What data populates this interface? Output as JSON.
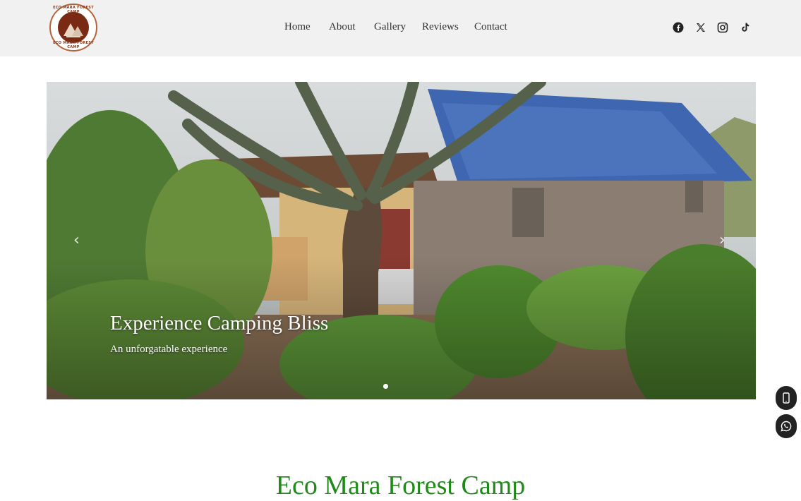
{
  "header": {
    "logo_text_top": "ECO MARA FOREST CAMP",
    "logo_text_bottom": "ECO MARA FOREST CAMP",
    "nav": [
      {
        "label": "Home"
      },
      {
        "label": "About"
      },
      {
        "label": "Gallery"
      },
      {
        "label": "Reviews"
      },
      {
        "label": "Contact"
      }
    ],
    "social_icons": [
      "facebook-icon",
      "x-icon",
      "instagram-icon",
      "tiktok-icon"
    ]
  },
  "hero": {
    "title": "Experience Camping Bliss",
    "subtitle": "An unforgatable experience",
    "prev_arrow": "‹",
    "next_arrow": "›",
    "slides_count": 3,
    "active_slide": 2
  },
  "floating": {
    "icons": [
      "phone-icon",
      "whatsapp-icon"
    ]
  },
  "section": {
    "title": "Eco Mara Forest Camp"
  },
  "colors": {
    "nav_bg": "#f1f1f1",
    "section_title": "#1f8a17",
    "logo_brown": "#7a2a12",
    "float_bg": "#222222"
  }
}
